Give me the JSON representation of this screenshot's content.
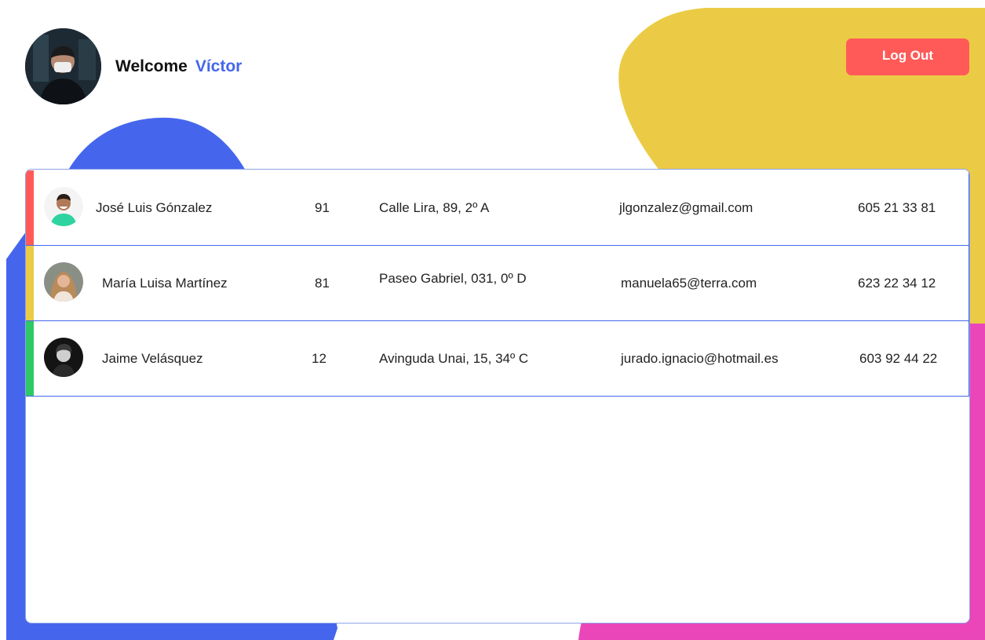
{
  "header": {
    "welcome_label": "Welcome",
    "user_name": "Víctor"
  },
  "actions": {
    "logout_label": "Log Out"
  },
  "colors": {
    "accent_blue": "#4566ec",
    "logout_red": "#ff5a58",
    "blob_yellow": "#ebcb46",
    "blob_pink": "#ea45b9"
  },
  "contacts": [
    {
      "name": "José Luis Gónzalez",
      "age": "91",
      "address": "Calle Lira, 89, 2º A",
      "email": "jlgonzalez@gmail.com",
      "phone": "605 21 33 81",
      "stripe_color": "#ff5a58"
    },
    {
      "name": "María Luisa Martínez",
      "age": "81",
      "address": "Paseo Gabriel, 031, 0º D",
      "email": "manuela65@terra.com",
      "phone": "623 22 34 12",
      "stripe_color": "#ebcb46"
    },
    {
      "name": "Jaime Velásquez",
      "age": "12",
      "address": "Avinguda Unai, 15, 34º C",
      "email": "jurado.ignacio@hotmail.es",
      "phone": "603 92 44 22",
      "stripe_color": "#2ec964"
    }
  ]
}
